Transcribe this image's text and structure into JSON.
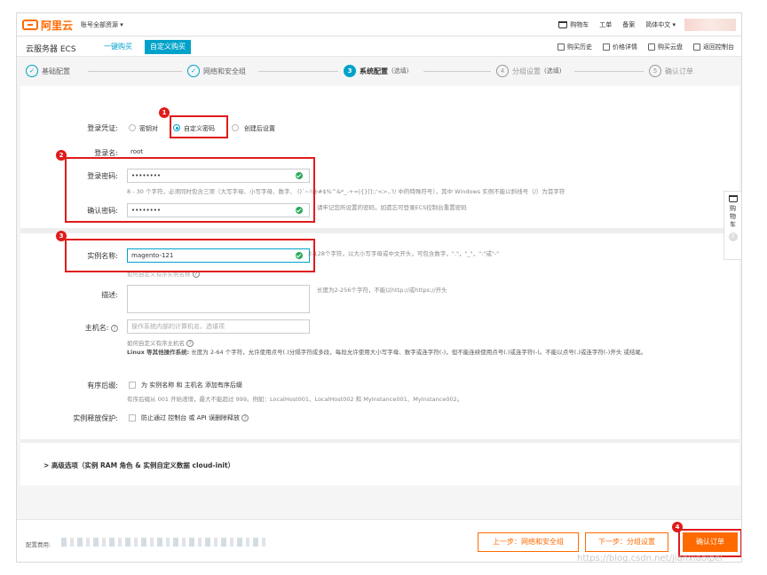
{
  "topbar": {
    "logo_text": "阿里云",
    "account_label": "账号全部资源 ▾",
    "nav": {
      "cart": "购物车",
      "orders": "工单",
      "filing": "备案",
      "language": "简体中文 ▾"
    }
  },
  "subbar": {
    "title": "云服务器 ECS",
    "tab_quick": "一键购买",
    "tab_custom": "自定义购买",
    "links": {
      "history": "购买历史",
      "price": "价格详情",
      "cloud_disk": "购买云盘",
      "console": "返回控制台"
    }
  },
  "steps": [
    {
      "num": "✓",
      "label": "基础配置",
      "state": "done"
    },
    {
      "num": "✓",
      "label": "网络和安全组",
      "state": "done"
    },
    {
      "num": "3",
      "label": "系统配置",
      "optional": "(选填)",
      "state": "active"
    },
    {
      "num": "4",
      "label": "分组设置",
      "optional": "(选填)",
      "state": "todo"
    },
    {
      "num": "5",
      "label": "确认订单",
      "state": "todo"
    }
  ],
  "form": {
    "login_label": "登录凭证:",
    "login_options": {
      "keypair": "密钥对",
      "custom_pwd": "自定义密码",
      "later": "创建后设置"
    },
    "username_label": "登录名:",
    "username_value": "root",
    "password_label": "登录密码:",
    "password_value": "••••••••",
    "password_hint": "8 - 30 个字符，必须同时包含三项（大写字母、小写字母、数字、 ()`~!@#$%^&*_-+=|{}[]:;'<>,.?/ 中的特殊符号），其中 Windows 实例不能以斜线号（/）为首字符",
    "confirm_label": "确认密码:",
    "confirm_value": "••••••••",
    "confirm_hint": "请牢记您所设置的密码，如遗忘可登录ECS控制台重置密码",
    "instance_label": "实例名称:",
    "instance_value": "magento-121",
    "instance_hint": "2-128个字符，以大小写字母或中文开头，可包含数字，\".\"，\"_\"，\":\"或\"-\"",
    "instance_sublink": "如何自定义有序实例名称",
    "desc_label": "描述:",
    "desc_hint": "长度为2-256个字符，不能以http://或https://开头",
    "host_label": "主机名:",
    "host_placeholder": "操作系统内部的计算机名，选填项",
    "host_sublink": "如何自定义有序主机名",
    "host_rule_bold": "Linux 等其他操作系统:",
    "host_rule": "长度为 2-64 个字符，允许使用点号(.)分隔字符成多段，每段允许使用大小写字母、数字或连字符(-)，但不能连续使用点号(.)或连字符(-)。不能以点号(.)或连字符(-)开头",
    "host_rule_end": "或结尾。",
    "suffix_label": "有序后缀:",
    "suffix_check_text": "为 实例名称 和 主机名 添加有序后缀",
    "suffix_hint": "有序后缀从 001 开始递增，最大不能超过 999。例如：LocalHost001、LocalHost002 和 MyInstance001、MyInstance002。",
    "protect_label": "实例释放保护:",
    "protect_check_text": "防止通过 控制台 或 API 误删除释放",
    "advanced": "> 高级选项（实例 RAM 角色 & 实例自定义数据 cloud-init）"
  },
  "floatcart": {
    "text": "购物车",
    "count": "0"
  },
  "footer": {
    "fee_label": "配置费用:",
    "prev_button": "上一步：网络和安全组",
    "next_button": "下一步：分组设置",
    "confirm_button": "确认订单"
  },
  "annotations": [
    "1",
    "2",
    "3",
    "4"
  ],
  "watermark": "https://blog.csdn.net/jianxiaoipei",
  "colors": {
    "accent": "#00a2ca",
    "brand": "#ff6a00",
    "highlight": "#e01b1b",
    "success": "#2aaa5a"
  }
}
